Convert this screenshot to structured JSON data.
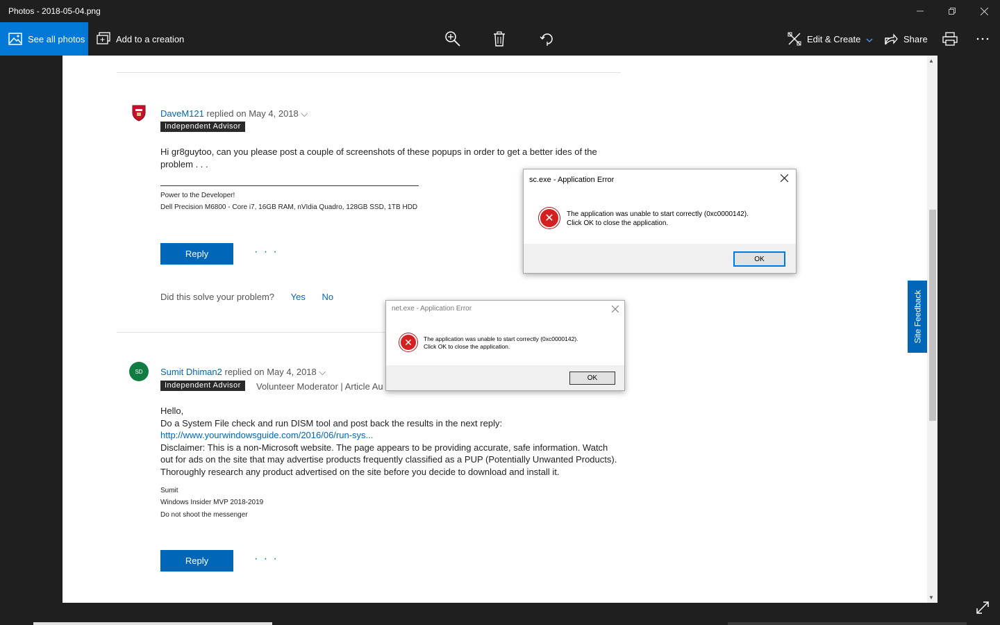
{
  "window": {
    "title": "Photos - 2018-05-04.png"
  },
  "toolbar": {
    "see_all_label": "See all photos",
    "add_to_creation_label": "Add to a creation",
    "edit_create_label": "Edit & Create",
    "share_label": "Share",
    "accent_color": "#0078d7"
  },
  "post1": {
    "author": "DaveM121",
    "replied": "replied on May 4, 2018",
    "badge": "Independent Advisor",
    "body_line1": "Hi gr8guytoo, can you please post a couple of screenshots of these popups in order to get a better ides of the",
    "body_line2": "problem . . .",
    "sig_line1": "Power to the Developer!",
    "sig_line2": "Dell Precision M6800 - Core i7, 16GB RAM, nVIdia Quadro, 128GB SSD, 1TB HDD",
    "reply_label": "Reply",
    "more_label": "· · ·",
    "solve_question": "Did this solve your problem?",
    "yes_label": "Yes",
    "no_label": "No"
  },
  "post2": {
    "avatar_initials": "SD",
    "author": "Sumit Dhiman2",
    "replied": "replied on May 4, 2018",
    "badge": "Independent Advisor",
    "roles": "Volunteer Moderator | Article Au",
    "greeting": "Hello,",
    "line1": "Do a System File check and run DISM tool and post back the results in the next reply:",
    "link": "http://www.yourwindowsguide.com/2016/06/run-sys...",
    "disclaimer1": "Disclaimer: This is a non-Microsoft website. The page appears to be providing accurate, safe information. Watch",
    "disclaimer2": "out for ads on the site that may advertise products frequently classified as a PUP (Potentially Unwanted Products).",
    "disclaimer3": "Thoroughly research any product advertised on the site before you decide to download and install it.",
    "sig1": "Sumit",
    "sig2": "Windows Insider MVP 2018-2019",
    "sig3": "Do not shoot the messenger",
    "reply_label": "Reply",
    "more_label": "· · ·"
  },
  "site_feedback_label": "Site Feedback",
  "dialog_sc": {
    "title": "sc.exe - Application Error",
    "message_line1": "The application was unable to start correctly (0xc0000142).",
    "message_line2": "Click OK to close the application.",
    "ok_label": "OK"
  },
  "dialog_net": {
    "title": "net.exe - Application Error",
    "message_line1": "The application was unable to start correctly (0xc0000142).",
    "message_line2": "Click OK to close the application.",
    "ok_label": "OK"
  }
}
